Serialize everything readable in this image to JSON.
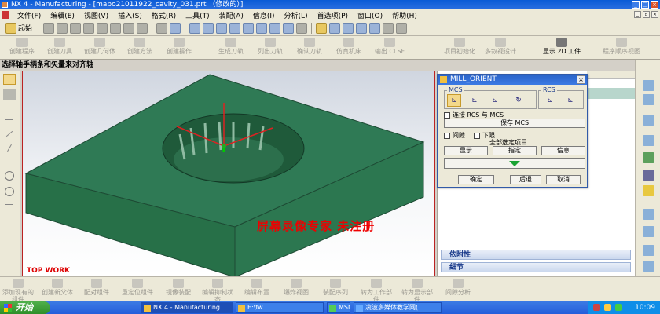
{
  "window": {
    "title": "NX 4 - Manufacturing - [mabo21011922_cavity_031.prt （修改的）]"
  },
  "menu": {
    "items": [
      "文件(F)",
      "编辑(E)",
      "视图(V)",
      "插入(S)",
      "格式(R)",
      "工具(T)",
      "装配(A)",
      "信息(I)",
      "分析(L)",
      "首选项(P)",
      "窗口(O)",
      "帮助(H)"
    ]
  },
  "toolbar": {
    "start_label": "起始"
  },
  "toolbar2": {
    "items": [
      "创建程序",
      "创建刀具",
      "创建几何体",
      "创建方法",
      "创建操作",
      "生成刀轨",
      "列出刀轨",
      "确认刀轨",
      "仿真机床",
      "输出 CLSF",
      "项目初始化",
      "多叙视设计",
      "显示 2D 工件",
      "程序顺序视图"
    ]
  },
  "prompt": {
    "text": "选择轴手柄条和矢量来对齐轴"
  },
  "viewport": {
    "watermark": "屏幕录像专家 未注册",
    "view_label": "TOP WORK",
    "part_color": "#2f7a55"
  },
  "dialog": {
    "title": "MILL_ORIENT",
    "mcs_group": "MCS",
    "rcs_group": "RCS",
    "link_rcs_mcs": "连接 RCS 与 MCS",
    "save_mcs": "保存 MCS",
    "clearance": "间隙",
    "lower_limit": "下限",
    "all_selected": "全部选定项目",
    "display": "显示",
    "specify": "指定",
    "info": "信息",
    "ok": "确定",
    "back": "后退",
    "cancel": "取消"
  },
  "navigator": {
    "dependencies": "依附性",
    "details": "细节"
  },
  "bottom_toolbar": {
    "items": [
      "添加现有的组件",
      "创建新父体",
      "配对组件",
      "重定位组件",
      "镜像装配",
      "编辑抑制状态",
      "编辑布置",
      "爆炸视图",
      "装配序列",
      "转为工作部件",
      "转为显示部件",
      "间隙分析"
    ]
  },
  "taskbar": {
    "start": "开始",
    "tasks": [
      "NX 4 - Manufacturing ...",
      "E:\\fw",
      "MSN",
      "凌波多媒体教学网(..."
    ],
    "clock": "10:09"
  }
}
